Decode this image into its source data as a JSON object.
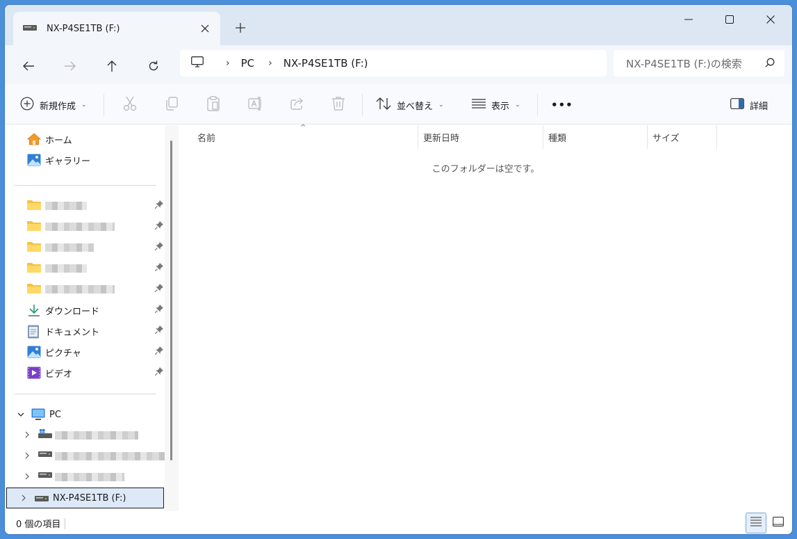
{
  "tab": {
    "title": "NX-P4SE1TB (F:)"
  },
  "window_controls": {
    "minimize": "minimize",
    "maximize": "maximize",
    "close": "close"
  },
  "address": {
    "crumbs": [
      "PC",
      "NX-P4SE1TB (F:)"
    ]
  },
  "search": {
    "placeholder": "NX-P4SE1TB (F:)の検索"
  },
  "commands": {
    "new": "新規作成",
    "sort": "並べ替え",
    "view": "表示",
    "more": "•••",
    "details": "詳細"
  },
  "sidebar": {
    "home": "ホーム",
    "gallery": "ギャラリー",
    "pinned": [
      {
        "label": "",
        "icon": "folder-icon"
      },
      {
        "label": "",
        "icon": "folder-icon"
      },
      {
        "label": "",
        "icon": "folder-icon"
      },
      {
        "label": "",
        "icon": "folder-icon"
      },
      {
        "label": "",
        "icon": "folder-icon"
      }
    ],
    "downloads": "ダウンロード",
    "documents": "ドキュメント",
    "pictures": "ピクチャ",
    "videos": "ビデオ",
    "pc": "PC",
    "drive_selected": "NX-P4SE1TB (F:)"
  },
  "columns": {
    "name": "名前",
    "modified": "更新日時",
    "type": "種類",
    "size": "サイズ"
  },
  "empty_message": "このフォルダーは空です。",
  "status": {
    "count": "0 個の項目"
  },
  "colors": {
    "accent": "#0067c0",
    "titlebar": "#dce7f3",
    "selection": "#dde9f7"
  }
}
